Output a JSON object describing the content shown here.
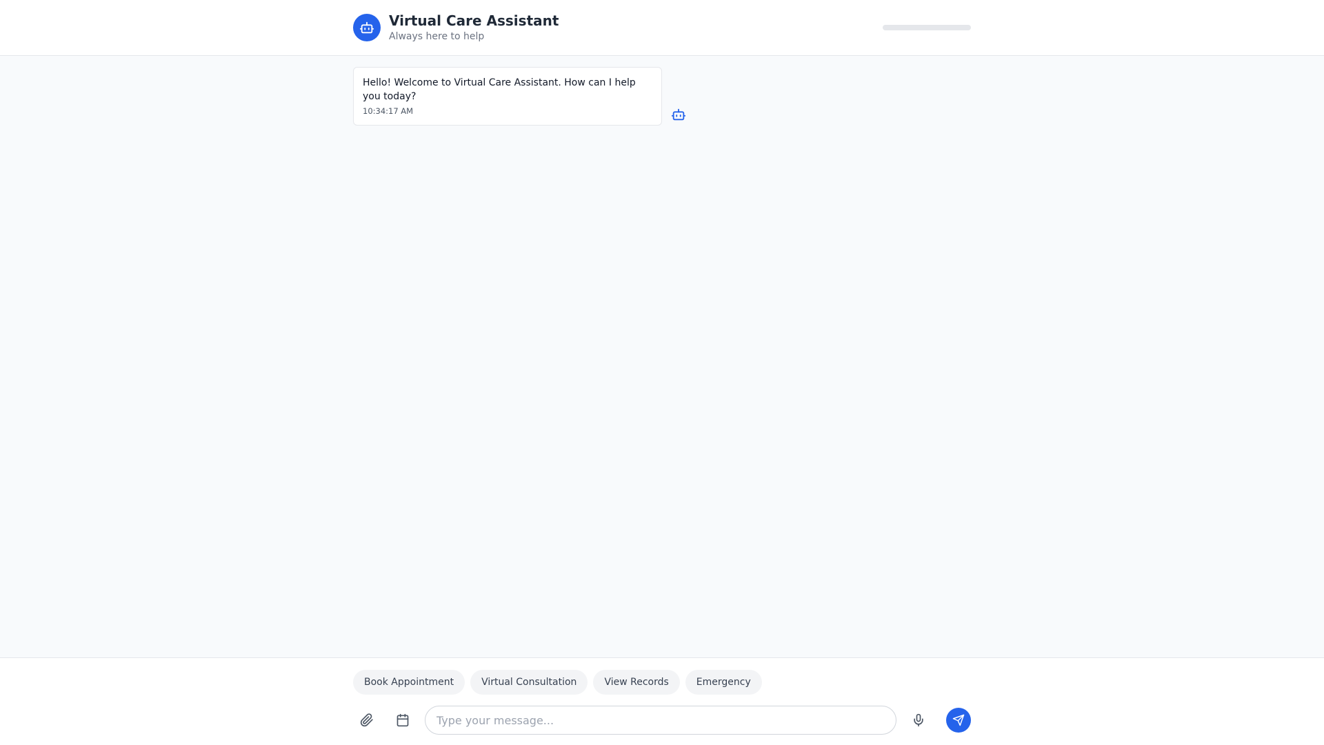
{
  "header": {
    "title": "Virtual Care Assistant",
    "subtitle": "Always here to help",
    "avatar_icon": "bot-icon",
    "accent_color": "#2563eb"
  },
  "messages": [
    {
      "sender": "assistant",
      "text": "Hello! Welcome to Virtual Care Assistant. How can I help you today?",
      "time": "10:34:17 AM",
      "icon": "bot-icon"
    }
  ],
  "quick_actions": [
    {
      "label": "Book Appointment"
    },
    {
      "label": "Virtual Consultation"
    },
    {
      "label": "View Records"
    },
    {
      "label": "Emergency"
    }
  ],
  "composer": {
    "placeholder": "Type your message...",
    "value": "",
    "icons": [
      "paperclip-icon",
      "calendar-icon",
      "microphone-icon",
      "send-icon"
    ]
  }
}
